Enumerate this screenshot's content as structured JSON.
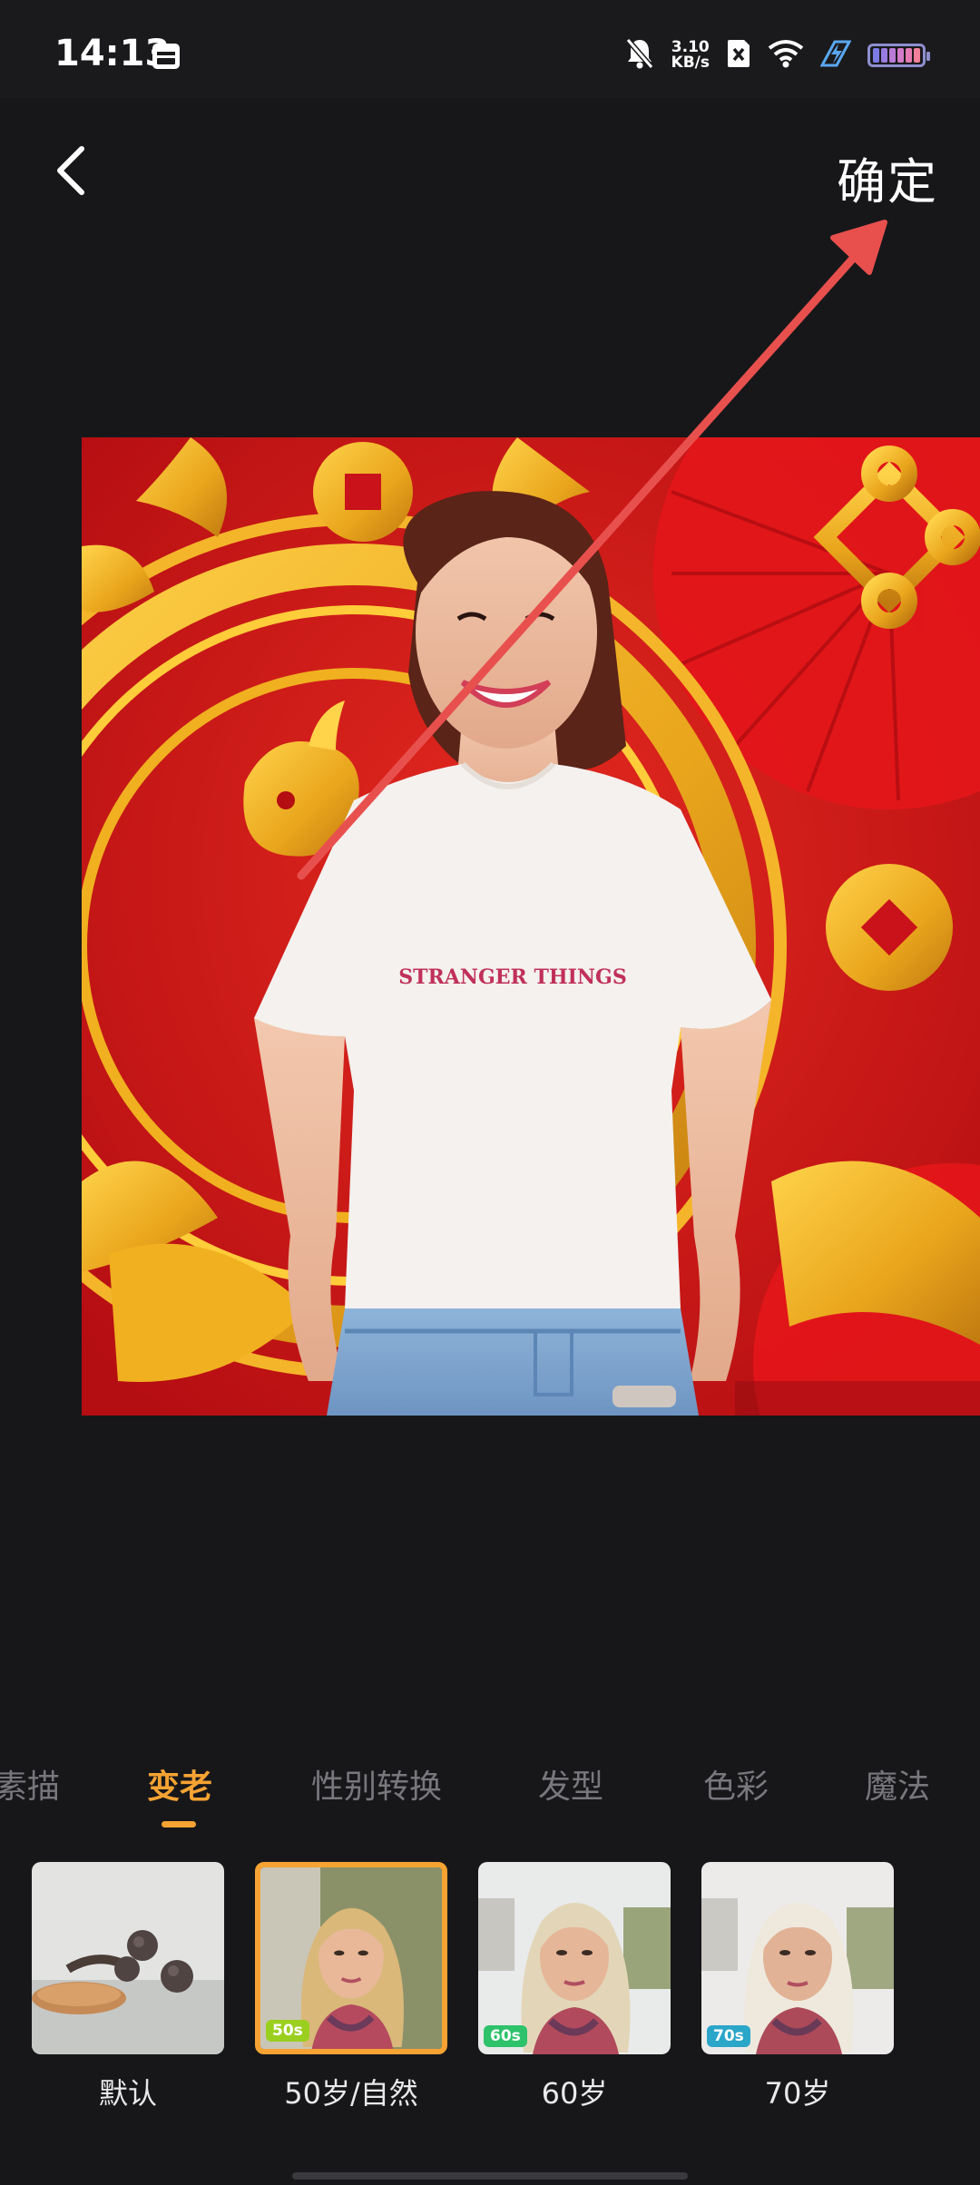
{
  "status_bar": {
    "time": "14:13",
    "net_speed_value": "3.10",
    "net_speed_unit": "KB/s",
    "icons": [
      "calendar-icon",
      "mute-bell-icon",
      "sim-off-icon",
      "wifi-icon",
      "flash-charge-icon",
      "battery-icon"
    ]
  },
  "header": {
    "back_icon": "chevron-left-icon",
    "confirm_label": "确定"
  },
  "photo": {
    "shirt_print": "STRANGER THINGS"
  },
  "tabs": {
    "items": [
      "素描",
      "变老",
      "性别转换",
      "发型",
      "色彩",
      "魔法"
    ],
    "active_index": 1,
    "active_color": "#f6a333"
  },
  "effects": {
    "items": [
      {
        "label": "默认",
        "badge": "",
        "selected": false
      },
      {
        "label": "50岁/自然",
        "badge": "50s",
        "badge_color": "#9bcf1f",
        "selected": true
      },
      {
        "label": "60岁",
        "badge": "60s",
        "badge_color": "#2ec26a",
        "selected": false
      },
      {
        "label": "70岁",
        "badge": "70s",
        "badge_color": "#2aa6c9",
        "selected": false
      }
    ]
  },
  "colors": {
    "background": "#17171a",
    "accent": "#f6a333",
    "annotation_arrow": "#e8504e"
  }
}
